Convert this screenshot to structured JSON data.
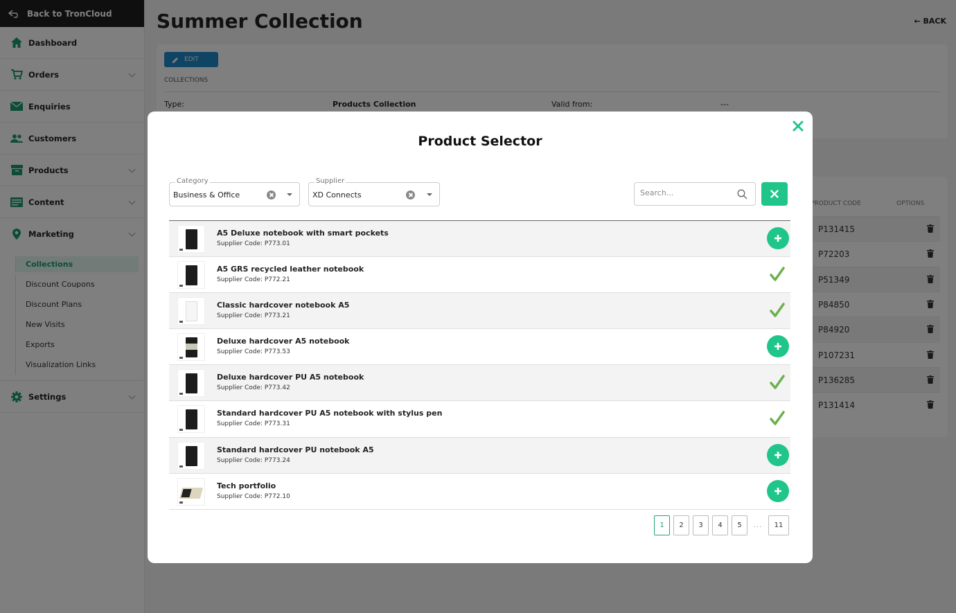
{
  "sidebar": {
    "back_label": "Back to TronCloud",
    "items": [
      {
        "label": "Dashboard",
        "icon": "home-icon"
      },
      {
        "label": "Orders",
        "icon": "cart-icon"
      },
      {
        "label": "Enquiries",
        "icon": "mail-icon"
      },
      {
        "label": "Customers",
        "icon": "users-icon"
      },
      {
        "label": "Products",
        "icon": "box-icon"
      },
      {
        "label": "Content",
        "icon": "content-icon"
      },
      {
        "label": "Marketing",
        "icon": "marker-icon"
      },
      {
        "label": "Settings",
        "icon": "gear-icon"
      }
    ],
    "marketing_sub": [
      "Collections",
      "Discount Coupons",
      "Discount Plans",
      "New Visits",
      "Exports",
      "Visualization Links"
    ]
  },
  "page": {
    "title": "Summer Collection",
    "back_label": "BACK",
    "edit_label": "EDIT",
    "collections_label": "COLLECTIONS",
    "type_label": "Type:",
    "type_value": "Products Collection",
    "valid_from_label": "Valid from:",
    "valid_from_value": "---"
  },
  "background_table": {
    "headers": [
      "PRODUCT CODE",
      "OPTIONS"
    ],
    "codes": [
      "P131415",
      "P72203",
      "P51349",
      "P84850",
      "P84920",
      "P107231",
      "P136285",
      "P131414"
    ]
  },
  "modal": {
    "title": "Product Selector",
    "category": {
      "label": "Category",
      "value": "Business & Office"
    },
    "supplier": {
      "label": "Supplier",
      "value": "XD Connects"
    },
    "search_placeholder": "Search...",
    "supplier_code_prefix": "Supplier Code:",
    "products": [
      {
        "name": "A5 Deluxe notebook with smart pockets",
        "code": "Supplier Code: P773.01",
        "state": "add",
        "thumb": "black"
      },
      {
        "name": "A5 GRS recycled leather notebook",
        "code": "Supplier Code: P772.21",
        "state": "added",
        "thumb": "black"
      },
      {
        "name": "Classic hardcover notebook A5",
        "code": "Supplier Code: P773.21",
        "state": "added",
        "thumb": "white"
      },
      {
        "name": "Deluxe hardcover A5 notebook",
        "code": "Supplier Code: P773.53",
        "state": "add",
        "thumb": "band"
      },
      {
        "name": "Deluxe hardcover PU A5 notebook",
        "code": "Supplier Code: P773.42",
        "state": "added",
        "thumb": "black"
      },
      {
        "name": "Standard hardcover PU A5 notebook with stylus pen",
        "code": "Supplier Code: P773.31",
        "state": "added",
        "thumb": "black"
      },
      {
        "name": "Standard hardcover PU notebook A5",
        "code": "Supplier Code: P773.24",
        "state": "add",
        "thumb": "black"
      },
      {
        "name": "Tech portfolio",
        "code": "Supplier Code: P772.10",
        "state": "add",
        "thumb": "folio"
      }
    ],
    "pagination": {
      "pages": [
        "1",
        "2",
        "3",
        "4",
        "5"
      ],
      "ellipsis": "...",
      "last": "11",
      "current": "1"
    }
  },
  "colors": {
    "accent": "#1fc589",
    "check": "#6ab04c",
    "edit": "#1e88c8"
  }
}
